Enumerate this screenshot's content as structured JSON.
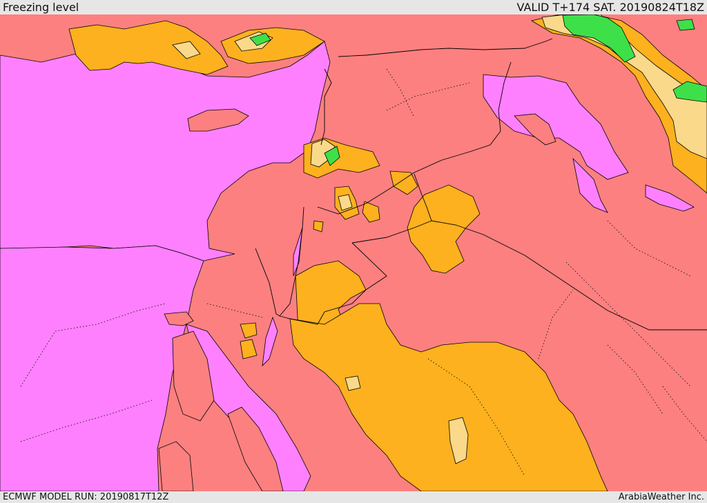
{
  "header": {
    "title": "Freezing level",
    "valid": "VALID T+174 SAT. 20190824T18Z"
  },
  "footer": {
    "model_run": "ECMWF MODEL RUN: 20190817T12Z",
    "credit": "ArabiaWeather Inc."
  },
  "colors": {
    "salmon": "#fd8080",
    "magenta": "#ff80ff",
    "orange": "#fdb11e",
    "pale_yellow": "#fbd98a",
    "green": "#3ee04a"
  }
}
